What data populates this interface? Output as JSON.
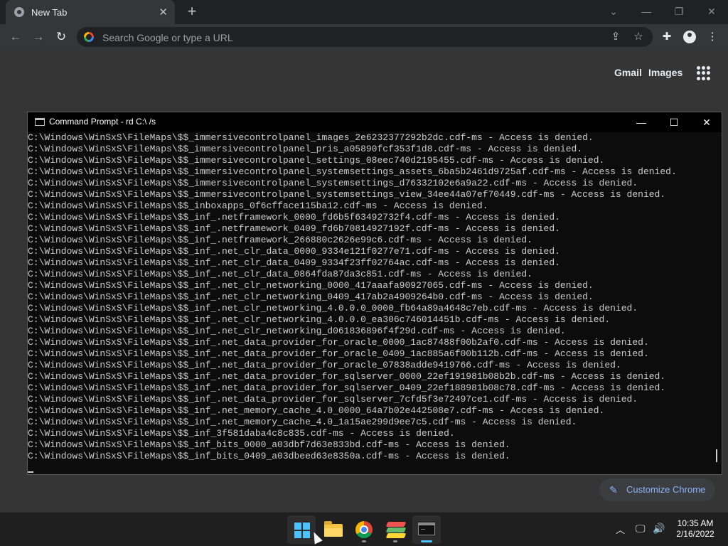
{
  "browser": {
    "tab": {
      "title": "New Tab",
      "close": "✕"
    },
    "new_tab_symbol": "+",
    "window_controls": {
      "dropdown": "⌄",
      "minimize": "—",
      "restore": "❐",
      "close": "✕"
    },
    "nav": {
      "back": "←",
      "forward": "→",
      "reload": "↻"
    },
    "omnibox": {
      "placeholder": "Search Google or type a URL"
    },
    "omnibox_icons": {
      "share": "⇪",
      "bookmark": "☆"
    },
    "toolbar_icons": {
      "extensions": "✚",
      "menu": "⋮"
    },
    "ntp": {
      "gmail": "Gmail",
      "images": "Images",
      "customize_label": "Customize Chrome",
      "customize_icon": "✎"
    }
  },
  "cmd": {
    "title": "Command Prompt - rd  C:\\ /s",
    "controls": {
      "minimize": "—",
      "maximize": "☐",
      "close": "✕"
    },
    "lines": [
      "C:\\Windows\\WinSxS\\FileMaps\\$$_immersivecontrolpanel_images_2e6232377292b2dc.cdf-ms - Access is denied.",
      "C:\\Windows\\WinSxS\\FileMaps\\$$_immersivecontrolpanel_pris_a05890fcf353f1d8.cdf-ms - Access is denied.",
      "C:\\Windows\\WinSxS\\FileMaps\\$$_immersivecontrolpanel_settings_08eec740d2195455.cdf-ms - Access is denied.",
      "C:\\Windows\\WinSxS\\FileMaps\\$$_immersivecontrolpanel_systemsettings_assets_6ba5b2461d9725af.cdf-ms - Access is denied.",
      "C:\\Windows\\WinSxS\\FileMaps\\$$_immersivecontrolpanel_systemsettings_d76332102e6a9a22.cdf-ms - Access is denied.",
      "C:\\Windows\\WinSxS\\FileMaps\\$$_immersivecontrolpanel_systemsettings_view_34ee44a07ef70449.cdf-ms - Access is denied.",
      "C:\\Windows\\WinSxS\\FileMaps\\$$_inboxapps_0f6cfface115ba12.cdf-ms - Access is denied.",
      "C:\\Windows\\WinSxS\\FileMaps\\$$_inf_.netframework_0000_fd6b5f63492732f4.cdf-ms - Access is denied.",
      "C:\\Windows\\WinSxS\\FileMaps\\$$_inf_.netframework_0409_fd6b70814927192f.cdf-ms - Access is denied.",
      "C:\\Windows\\WinSxS\\FileMaps\\$$_inf_.netframework_266880c2626e99c6.cdf-ms - Access is denied.",
      "C:\\Windows\\WinSxS\\FileMaps\\$$_inf_.net_clr_data_0000_9334e121f0277e71.cdf-ms - Access is denied.",
      "C:\\Windows\\WinSxS\\FileMaps\\$$_inf_.net_clr_data_0409_9334f23ff02764ac.cdf-ms - Access is denied.",
      "C:\\Windows\\WinSxS\\FileMaps\\$$_inf_.net_clr_data_0864fda87da3c851.cdf-ms - Access is denied.",
      "C:\\Windows\\WinSxS\\FileMaps\\$$_inf_.net_clr_networking_0000_417aaafa90927065.cdf-ms - Access is denied.",
      "C:\\Windows\\WinSxS\\FileMaps\\$$_inf_.net_clr_networking_0409_417ab2a4909264b0.cdf-ms - Access is denied.",
      "C:\\Windows\\WinSxS\\FileMaps\\$$_inf_.net_clr_networking_4.0.0.0_0000_fb64a89a4648c7eb.cdf-ms - Access is denied.",
      "C:\\Windows\\WinSxS\\FileMaps\\$$_inf_.net_clr_networking_4.0.0.0_ea306c746014451b.cdf-ms - Access is denied.",
      "C:\\Windows\\WinSxS\\FileMaps\\$$_inf_.net_clr_networking_d061836896f4f29d.cdf-ms - Access is denied.",
      "C:\\Windows\\WinSxS\\FileMaps\\$$_inf_.net_data_provider_for_oracle_0000_1ac87488f00b2af0.cdf-ms - Access is denied.",
      "C:\\Windows\\WinSxS\\FileMaps\\$$_inf_.net_data_provider_for_oracle_0409_1ac885a6f00b112b.cdf-ms - Access is denied.",
      "C:\\Windows\\WinSxS\\FileMaps\\$$_inf_.net_data_provider_for_oracle_07838adde9419766.cdf-ms - Access is denied.",
      "C:\\Windows\\WinSxS\\FileMaps\\$$_inf_.net_data_provider_for_sqlserver_0000_22ef191981b08b2b.cdf-ms - Access is denied.",
      "C:\\Windows\\WinSxS\\FileMaps\\$$_inf_.net_data_provider_for_sqlserver_0409_22ef188981b08c78.cdf-ms - Access is denied.",
      "C:\\Windows\\WinSxS\\FileMaps\\$$_inf_.net_data_provider_for_sqlserver_7cfd5f3e72497ce1.cdf-ms - Access is denied.",
      "C:\\Windows\\WinSxS\\FileMaps\\$$_inf_.net_memory_cache_4.0_0000_64a7b02e442508e7.cdf-ms - Access is denied.",
      "C:\\Windows\\WinSxS\\FileMaps\\$$_inf_.net_memory_cache_4.0_1a15ae299d9ee7c5.cdf-ms - Access is denied.",
      "C:\\Windows\\WinSxS\\FileMaps\\$$_inf_3f581daba4c8c835.cdf-ms - Access is denied.",
      "C:\\Windows\\WinSxS\\FileMaps\\$$_inf_bits_0000_a03dbf7d63e833bd.cdf-ms - Access is denied.",
      "C:\\Windows\\WinSxS\\FileMaps\\$$_inf_bits_0409_a03dbeed63e8350a.cdf-ms - Access is denied."
    ]
  },
  "taskbar": {
    "apps": [
      "start-icon",
      "file-explorer-icon",
      "chrome-icon",
      "stack-app-icon",
      "terminal-icon"
    ],
    "tray": {
      "chevron": "︿",
      "network": "🖵",
      "volume": "🔊"
    },
    "clock": {
      "time": "10:35 AM",
      "date": "2/16/2022"
    },
    "accent": "#4cc2ff"
  }
}
